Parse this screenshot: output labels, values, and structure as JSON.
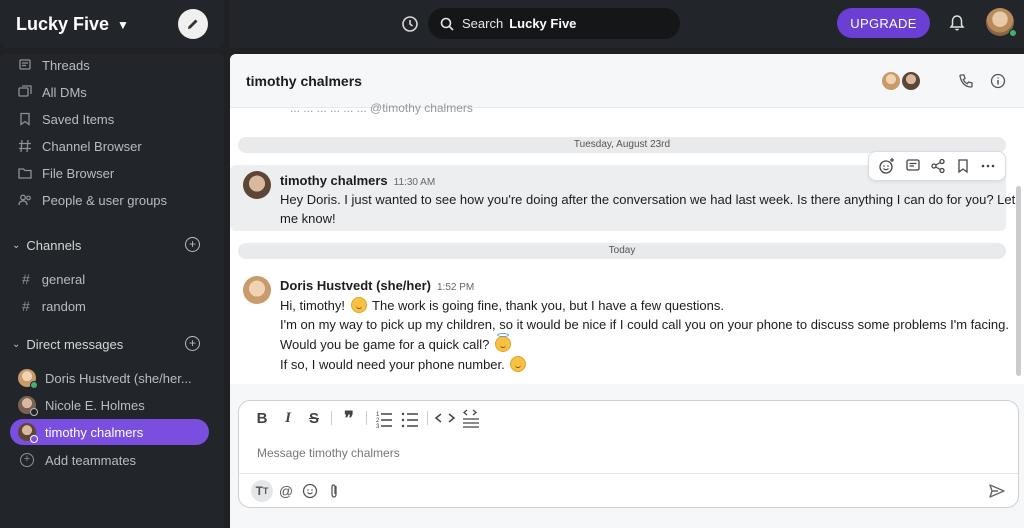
{
  "workspace": {
    "name": "Lucky Five"
  },
  "topbar": {
    "search_label": "Search",
    "search_scope": "Lucky Five",
    "upgrade_label": "UPGRADE"
  },
  "sidebar": {
    "nav": [
      {
        "label": "Threads",
        "icon": "threads-icon"
      },
      {
        "label": "All DMs",
        "icon": "all-dms-icon"
      },
      {
        "label": "Saved Items",
        "icon": "bookmark-icon"
      },
      {
        "label": "Channel Browser",
        "icon": "channel-browser-icon"
      },
      {
        "label": "File Browser",
        "icon": "file-browser-icon"
      },
      {
        "label": "People & user groups",
        "icon": "people-icon"
      }
    ],
    "channels_header": "Channels",
    "channels": [
      "general",
      "random"
    ],
    "dms_header": "Direct messages",
    "dms": [
      {
        "label": "Doris Hustvedt (she/her...",
        "status": "online"
      },
      {
        "label": "Nicole E. Holmes",
        "status": "away"
      },
      {
        "label": "timothy chalmers",
        "status": "away",
        "active": true
      }
    ],
    "add_teammates": "Add teammates"
  },
  "channel": {
    "title": "timothy chalmers",
    "cut_off_text": "... ... ... ... ... ... @timothy chalmers"
  },
  "dividers": {
    "first": "Tuesday, August 23rd",
    "second": "Today"
  },
  "messages": [
    {
      "author": "timothy chalmers",
      "time": "11:30 AM",
      "lines": [
        "Hey Doris. I just wanted to see how you're doing after the conversation we had last week. Is there anything I can do for you? Let",
        "me know!"
      ]
    },
    {
      "author": "Doris Hustvedt (she/her)",
      "time": "1:52 PM",
      "lines": [
        "Hi, timothy!",
        "The work is going fine, thank you, but I have a few questions.",
        "I'm on my way to pick up my children, so it would be nice if I could call you on your phone to discuss some problems I'm facing.",
        "Would you be game for a quick call?",
        "If so, I would need your phone number."
      ]
    }
  ],
  "composer": {
    "placeholder": "Message timothy chalmers"
  },
  "colors": {
    "accent": "#6b3fd4",
    "active_dm": "#7a4fe0",
    "sidebar": "#222529",
    "online": "#3cb371"
  }
}
